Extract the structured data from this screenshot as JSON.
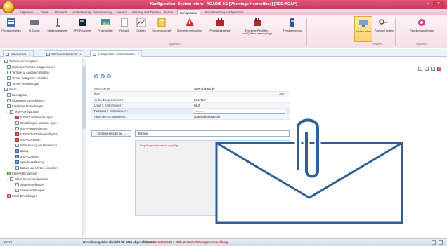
{
  "window": {
    "title": "Konfiguration: System Intern - AGADIS 9.1 [Wenntage Hosmetikse] [DDE:AGAP]",
    "controls": [
      "minimize",
      "maximize",
      "close"
    ]
  },
  "ribbon_tabs": [
    {
      "label": "Allgemein"
    },
    {
      "label": "Grafik"
    },
    {
      "label": "Protokoll"
    },
    {
      "label": "Hardwaremag"
    },
    {
      "label": "Fernsteuerung"
    },
    {
      "label": "Steuern"
    },
    {
      "label": "Wartung und Termine"
    },
    {
      "label": "Extras"
    },
    {
      "label": "Konfiguration"
    },
    {
      "label": "Fernsteuerung Konfiguration"
    }
  ],
  "ribbon": {
    "buttons": [
      {
        "label": "Prozessvariablen",
        "icon": "variables-icon"
      },
      {
        "label": "FI-Tasche",
        "icon": "keyboard-icon"
      },
      {
        "label": "Stationsparameter",
        "icon": "station-icon"
      },
      {
        "label": "SPS-Parameter",
        "icon": "plc-icon"
      },
      {
        "label": "Prozessbilder",
        "icon": "image-icon"
      },
      {
        "label": "Protokoll",
        "icon": "log-icon"
      },
      {
        "label": "Grafiken",
        "icon": "graph-icon"
      },
      {
        "label": "Rechenvorschrift",
        "icon": "calc-icon"
      },
      {
        "label": "Störmeldeverknüpfung",
        "icon": "alarm-link-icon"
      },
      {
        "label": "Prioritätseingänge",
        "icon": "priority-icon"
      },
      {
        "label": "Erweiterte Prioritäten-\nund Quittierungsausgänge",
        "icon": "priority-ext-icon"
      },
      {
        "label": "Fernalarmierung",
        "icon": "remote-alarm-icon"
      },
      {
        "label": "System Intern",
        "icon": "system-icon"
      },
      {
        "label": "Passwort ändern",
        "icon": "password-icon"
      },
      {
        "label": "Regelkreisaufbrisden",
        "icon": "control-loop-icon"
      }
    ],
    "groups": [
      "Allgemein",
      "System",
      "Optionen"
    ]
  },
  "doc_tabs": [
    {
      "label": "Hallesecher"
    },
    {
      "label": "Störmeldeübersicht"
    },
    {
      "label": "Konfiguration: System Intern"
    }
  ],
  "tree": [
    {
      "label": "Termine und Aufgaben",
      "level": 0,
      "icon": "folder"
    },
    {
      "label": "Wartungs-Termine reorganisieren",
      "level": 1,
      "icon": ""
    },
    {
      "label": "Termine u. Aufgaben löschen",
      "level": 1,
      "icon": ""
    },
    {
      "label": "Termin-Kategorien verwalten",
      "level": 1,
      "icon": ""
    },
    {
      "label": "Termin-Einstellungen",
      "level": 1,
      "icon": ""
    },
    {
      "label": "Intern",
      "level": 0,
      "icon": "folder"
    },
    {
      "label": "Lizenzgrafie",
      "level": 1,
      "icon": ""
    },
    {
      "label": "Allgemeine Einstellungen",
      "level": 1,
      "icon": ""
    },
    {
      "label": "Erweiterte Einstellungen",
      "level": 1,
      "icon": ""
    },
    {
      "label": "MSP-Konfiguration",
      "level": 1,
      "icon": "folder"
    },
    {
      "label": "MSP-Grundeinstellungen",
      "level": 2,
      "icon": "red"
    },
    {
      "label": "Einstellungen automat. Spei...",
      "level": 2,
      "icon": ""
    },
    {
      "label": "MSP-Parametrierung",
      "level": 2,
      "icon": ""
    },
    {
      "label": "MSP-Schnittstellenkonfigurat...",
      "level": 2,
      "icon": "red"
    },
    {
      "label": "MSP-Emulation",
      "level": 2,
      "icon": "red"
    },
    {
      "label": "Initialisierung der Modemsch...",
      "level": 2,
      "icon": ""
    },
    {
      "label": "Bonzy",
      "level": 2,
      "icon": "blue"
    },
    {
      "label": "MSP-Optionen",
      "level": 2,
      "icon": "blue"
    },
    {
      "label": "Speicheraufteilung",
      "level": 2,
      "icon": "blue"
    },
    {
      "label": "Datum und Uhrzeit einstellen",
      "level": 2,
      "icon": ""
    },
    {
      "label": "Clientverbindungen",
      "level": 1,
      "icon": "green"
    },
    {
      "label": "Client-Serverkonfiguration",
      "level": 1,
      "icon": "folder"
    },
    {
      "label": "Serverinstellungen",
      "level": 2,
      "icon": ""
    },
    {
      "label": "Clienteinstellungen",
      "level": 2,
      "icon": ""
    },
    {
      "label": "Email-Einstellungen",
      "level": 1,
      "icon": "pink"
    }
  ],
  "form": {
    "rows": [
      {
        "label": "Smtp-Server :",
        "value": "www.schrant.de"
      },
      {
        "label": "Port :",
        "value": "465"
      },
      {
        "label": "Verbindungssicherheit :",
        "value": "SSL/TLS"
      },
      {
        "label": "Login f. Smtp-Server :",
        "value": "kauf"
      },
      {
        "label": "Passwort f. Smtp-Server :",
        "value": "********"
      },
      {
        "label": "Absender-Emailadresse :",
        "value": "agasus@schrant.de"
      }
    ],
    "send_button": "Testmail senden an ...",
    "send_value": "Testmail",
    "recipients_hint": "Empfängeradresse ist ungültig !"
  },
  "status": {
    "left": "Bereit",
    "message": "Berechnung Jahresbericht für 2016 abgeschlossen.",
    "alert": "06.01.2016 19:58:48 > 30th. Zentrale Störung Feuermeldung"
  },
  "colors": {
    "titlebar": "#d6476e",
    "ribbon_bg": "#f8e8ee",
    "accent_blue": "#2f5f92",
    "error_red": "#d03434"
  }
}
